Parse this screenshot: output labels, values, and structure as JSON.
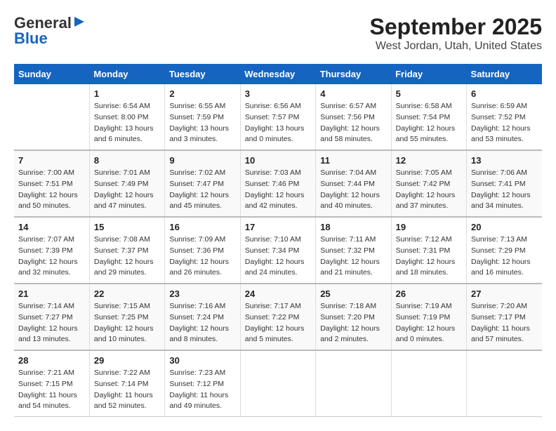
{
  "logo": {
    "general": "General",
    "blue": "Blue"
  },
  "title": "September 2025",
  "subtitle": "West Jordan, Utah, United States",
  "headers": [
    "Sunday",
    "Monday",
    "Tuesday",
    "Wednesday",
    "Thursday",
    "Friday",
    "Saturday"
  ],
  "weeks": [
    [
      {
        "day": "",
        "sunrise": "",
        "sunset": "",
        "daylight": ""
      },
      {
        "day": "1",
        "sunrise": "Sunrise: 6:54 AM",
        "sunset": "Sunset: 8:00 PM",
        "daylight": "Daylight: 13 hours and 6 minutes."
      },
      {
        "day": "2",
        "sunrise": "Sunrise: 6:55 AM",
        "sunset": "Sunset: 7:59 PM",
        "daylight": "Daylight: 13 hours and 3 minutes."
      },
      {
        "day": "3",
        "sunrise": "Sunrise: 6:56 AM",
        "sunset": "Sunset: 7:57 PM",
        "daylight": "Daylight: 13 hours and 0 minutes."
      },
      {
        "day": "4",
        "sunrise": "Sunrise: 6:57 AM",
        "sunset": "Sunset: 7:56 PM",
        "daylight": "Daylight: 12 hours and 58 minutes."
      },
      {
        "day": "5",
        "sunrise": "Sunrise: 6:58 AM",
        "sunset": "Sunset: 7:54 PM",
        "daylight": "Daylight: 12 hours and 55 minutes."
      },
      {
        "day": "6",
        "sunrise": "Sunrise: 6:59 AM",
        "sunset": "Sunset: 7:52 PM",
        "daylight": "Daylight: 12 hours and 53 minutes."
      }
    ],
    [
      {
        "day": "7",
        "sunrise": "Sunrise: 7:00 AM",
        "sunset": "Sunset: 7:51 PM",
        "daylight": "Daylight: 12 hours and 50 minutes."
      },
      {
        "day": "8",
        "sunrise": "Sunrise: 7:01 AM",
        "sunset": "Sunset: 7:49 PM",
        "daylight": "Daylight: 12 hours and 47 minutes."
      },
      {
        "day": "9",
        "sunrise": "Sunrise: 7:02 AM",
        "sunset": "Sunset: 7:47 PM",
        "daylight": "Daylight: 12 hours and 45 minutes."
      },
      {
        "day": "10",
        "sunrise": "Sunrise: 7:03 AM",
        "sunset": "Sunset: 7:46 PM",
        "daylight": "Daylight: 12 hours and 42 minutes."
      },
      {
        "day": "11",
        "sunrise": "Sunrise: 7:04 AM",
        "sunset": "Sunset: 7:44 PM",
        "daylight": "Daylight: 12 hours and 40 minutes."
      },
      {
        "day": "12",
        "sunrise": "Sunrise: 7:05 AM",
        "sunset": "Sunset: 7:42 PM",
        "daylight": "Daylight: 12 hours and 37 minutes."
      },
      {
        "day": "13",
        "sunrise": "Sunrise: 7:06 AM",
        "sunset": "Sunset: 7:41 PM",
        "daylight": "Daylight: 12 hours and 34 minutes."
      }
    ],
    [
      {
        "day": "14",
        "sunrise": "Sunrise: 7:07 AM",
        "sunset": "Sunset: 7:39 PM",
        "daylight": "Daylight: 12 hours and 32 minutes."
      },
      {
        "day": "15",
        "sunrise": "Sunrise: 7:08 AM",
        "sunset": "Sunset: 7:37 PM",
        "daylight": "Daylight: 12 hours and 29 minutes."
      },
      {
        "day": "16",
        "sunrise": "Sunrise: 7:09 AM",
        "sunset": "Sunset: 7:36 PM",
        "daylight": "Daylight: 12 hours and 26 minutes."
      },
      {
        "day": "17",
        "sunrise": "Sunrise: 7:10 AM",
        "sunset": "Sunset: 7:34 PM",
        "daylight": "Daylight: 12 hours and 24 minutes."
      },
      {
        "day": "18",
        "sunrise": "Sunrise: 7:11 AM",
        "sunset": "Sunset: 7:32 PM",
        "daylight": "Daylight: 12 hours and 21 minutes."
      },
      {
        "day": "19",
        "sunrise": "Sunrise: 7:12 AM",
        "sunset": "Sunset: 7:31 PM",
        "daylight": "Daylight: 12 hours and 18 minutes."
      },
      {
        "day": "20",
        "sunrise": "Sunrise: 7:13 AM",
        "sunset": "Sunset: 7:29 PM",
        "daylight": "Daylight: 12 hours and 16 minutes."
      }
    ],
    [
      {
        "day": "21",
        "sunrise": "Sunrise: 7:14 AM",
        "sunset": "Sunset: 7:27 PM",
        "daylight": "Daylight: 12 hours and 13 minutes."
      },
      {
        "day": "22",
        "sunrise": "Sunrise: 7:15 AM",
        "sunset": "Sunset: 7:25 PM",
        "daylight": "Daylight: 12 hours and 10 minutes."
      },
      {
        "day": "23",
        "sunrise": "Sunrise: 7:16 AM",
        "sunset": "Sunset: 7:24 PM",
        "daylight": "Daylight: 12 hours and 8 minutes."
      },
      {
        "day": "24",
        "sunrise": "Sunrise: 7:17 AM",
        "sunset": "Sunset: 7:22 PM",
        "daylight": "Daylight: 12 hours and 5 minutes."
      },
      {
        "day": "25",
        "sunrise": "Sunrise: 7:18 AM",
        "sunset": "Sunset: 7:20 PM",
        "daylight": "Daylight: 12 hours and 2 minutes."
      },
      {
        "day": "26",
        "sunrise": "Sunrise: 7:19 AM",
        "sunset": "Sunset: 7:19 PM",
        "daylight": "Daylight: 12 hours and 0 minutes."
      },
      {
        "day": "27",
        "sunrise": "Sunrise: 7:20 AM",
        "sunset": "Sunset: 7:17 PM",
        "daylight": "Daylight: 11 hours and 57 minutes."
      }
    ],
    [
      {
        "day": "28",
        "sunrise": "Sunrise: 7:21 AM",
        "sunset": "Sunset: 7:15 PM",
        "daylight": "Daylight: 11 hours and 54 minutes."
      },
      {
        "day": "29",
        "sunrise": "Sunrise: 7:22 AM",
        "sunset": "Sunset: 7:14 PM",
        "daylight": "Daylight: 11 hours and 52 minutes."
      },
      {
        "day": "30",
        "sunrise": "Sunrise: 7:23 AM",
        "sunset": "Sunset: 7:12 PM",
        "daylight": "Daylight: 11 hours and 49 minutes."
      },
      {
        "day": "",
        "sunrise": "",
        "sunset": "",
        "daylight": ""
      },
      {
        "day": "",
        "sunrise": "",
        "sunset": "",
        "daylight": ""
      },
      {
        "day": "",
        "sunrise": "",
        "sunset": "",
        "daylight": ""
      },
      {
        "day": "",
        "sunrise": "",
        "sunset": "",
        "daylight": ""
      }
    ]
  ]
}
